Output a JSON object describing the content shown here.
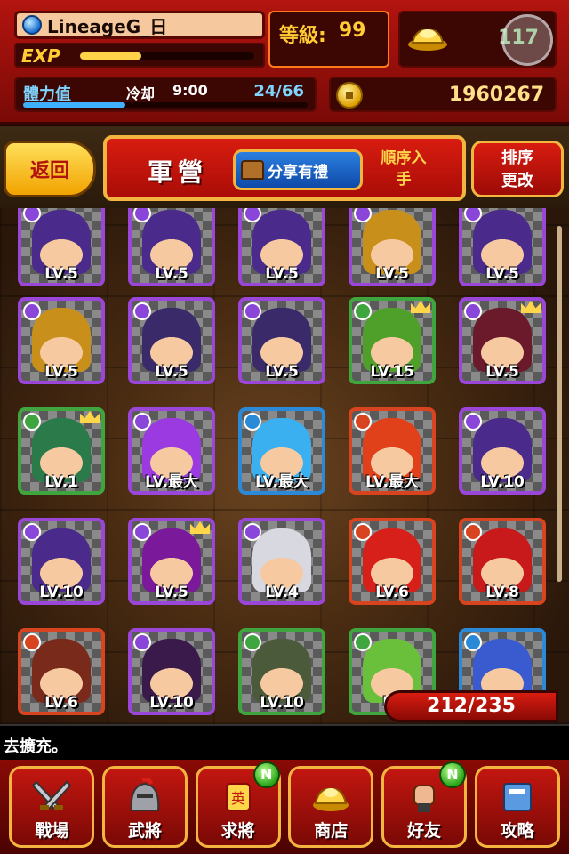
{
  "player": {
    "name": "LineageG_日",
    "level_label": "等級:",
    "level": "99",
    "exp_label": "EXP",
    "exp_fraction": 0.35,
    "gold": "117",
    "stamina_label": "體力值",
    "cooldown_label": "冷却",
    "cooldown_time": "9:00",
    "stamina": "24/66",
    "stamina_fraction": 0.36,
    "coins": "1960267"
  },
  "header": {
    "back_label": "返回",
    "title": "軍營",
    "share_label": "分享有禮",
    "order_label": "順序入手",
    "sort_label_1": "排序",
    "sort_label_2": "更改"
  },
  "cards": [
    {
      "lv": "LV.5",
      "frame": "purple",
      "elem": "#8a46d8",
      "hair": "#4a2a8a"
    },
    {
      "lv": "LV.5",
      "frame": "purple",
      "elem": "#8a46d8",
      "hair": "#4a2a8a"
    },
    {
      "lv": "LV.5",
      "frame": "purple",
      "elem": "#8a46d8",
      "hair": "#4a2a8a"
    },
    {
      "lv": "LV.5",
      "frame": "purple",
      "elem": "#8a46d8",
      "hair": "#c8901a"
    },
    {
      "lv": "LV.5",
      "frame": "purple",
      "elem": "#8a46d8",
      "hair": "#4a2a8a"
    },
    {
      "lv": "LV.5",
      "frame": "purple",
      "elem": "#8a46d8",
      "hair": "#c8901a"
    },
    {
      "lv": "LV.5",
      "frame": "purple",
      "elem": "#8a46d8",
      "hair": "#3a2a6a"
    },
    {
      "lv": "LV.5",
      "frame": "purple",
      "elem": "#8a46d8",
      "hair": "#3a2a6a"
    },
    {
      "lv": "LV.15",
      "frame": "green",
      "elem": "#3fa63f",
      "hair": "#4fa02a",
      "crown": true
    },
    {
      "lv": "LV.5",
      "frame": "purple",
      "elem": "#8a46d8",
      "hair": "#6a1a2a",
      "crown": true
    },
    {
      "lv": "LV.1",
      "frame": "green",
      "elem": "#3fa63f",
      "hair": "#2a7a4a",
      "crown": true
    },
    {
      "lv": "LV.最大",
      "frame": "purple",
      "elem": "#8a46d8",
      "hair": "#9a3ae0"
    },
    {
      "lv": "LV.最大",
      "frame": "blue",
      "elem": "#2a8ad8",
      "hair": "#3ab0f0"
    },
    {
      "lv": "LV.最大",
      "frame": "red",
      "elem": "#d8441f",
      "hair": "#e0401a"
    },
    {
      "lv": "LV.10",
      "frame": "purple",
      "elem": "#8a46d8",
      "hair": "#4a2a8a"
    },
    {
      "lv": "LV.10",
      "frame": "purple",
      "elem": "#8a46d8",
      "hair": "#4a2a8a"
    },
    {
      "lv": "LV.5",
      "frame": "purple",
      "elem": "#8a46d8",
      "hair": "#7a1a9a",
      "crown": true
    },
    {
      "lv": "LV.4",
      "frame": "purple",
      "elem": "#8a46d8",
      "hair": "#d8d8e0"
    },
    {
      "lv": "LV.6",
      "frame": "red",
      "elem": "#d8441f",
      "hair": "#d8201a"
    },
    {
      "lv": "LV.8",
      "frame": "red",
      "elem": "#d8441f",
      "hair": "#c81a1a"
    },
    {
      "lv": "LV.6",
      "frame": "red",
      "elem": "#d8441f",
      "hair": "#7a2a1a"
    },
    {
      "lv": "LV.10",
      "frame": "purple",
      "elem": "#8a46d8",
      "hair": "#3a1a4a"
    },
    {
      "lv": "LV.10",
      "frame": "green",
      "elem": "#3fa63f",
      "hair": "#4a5a3a"
    },
    {
      "lv": "LV",
      "frame": "green",
      "elem": "#3fa63f",
      "hair": "#6ac03a"
    },
    {
      "lv": "",
      "frame": "blue",
      "elem": "#2a8ad8",
      "hair": "#3a5ad0"
    }
  ],
  "card_count": "212/235",
  "message": "去擴充。",
  "nav": [
    {
      "label": "戰場",
      "icon": "crossed-swords-icon",
      "badge": ""
    },
    {
      "label": "武將",
      "icon": "helmet-icon",
      "badge": ""
    },
    {
      "label": "求將",
      "icon": "summon-scroll-icon",
      "badge": "N"
    },
    {
      "label": "商店",
      "icon": "gold-ingot-icon",
      "badge": ""
    },
    {
      "label": "好友",
      "icon": "fist-icon",
      "badge": "N"
    },
    {
      "label": "攻略",
      "icon": "book-icon",
      "badge": ""
    }
  ]
}
